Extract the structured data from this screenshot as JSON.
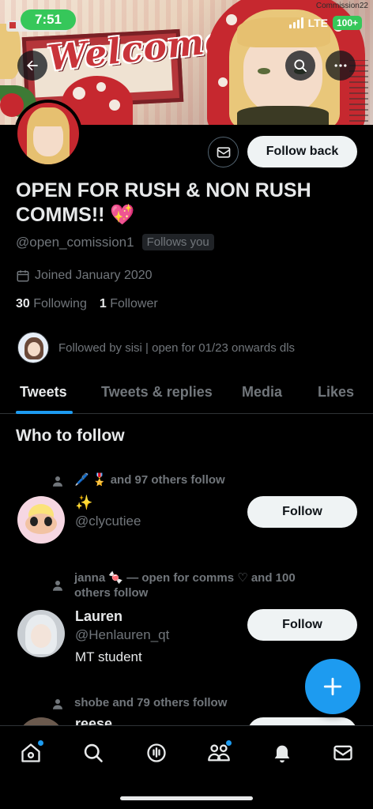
{
  "status_bar": {
    "time": "7:51",
    "network": "LTE",
    "battery": "100+"
  },
  "banner": {
    "welcome_text": "Welcome!",
    "corner_text": "Commission22"
  },
  "profile": {
    "display_name": "OPEN FOR RUSH & NON RUSH COMMS!! 💖",
    "handle": "@open_comission1",
    "follows_you": "Follows you",
    "joined": "Joined January 2020",
    "following_count": "30",
    "following_label": "Following",
    "followers_count": "1",
    "followers_label": "Follower",
    "followed_by": "Followed by sisi | open for 01/23 onwards dls",
    "follow_back_label": "Follow back"
  },
  "tabs": [
    {
      "label": "Tweets",
      "active": true
    },
    {
      "label": "Tweets & replies",
      "active": false
    },
    {
      "label": "Media",
      "active": false
    },
    {
      "label": "Likes",
      "active": false
    }
  ],
  "who_to_follow": {
    "title": "Who to follow",
    "suggestions": [
      {
        "social_context": "🖊️ 🎖️ and 97 others follow",
        "name": "✨",
        "handle": "@clycutiee",
        "bio": "",
        "button": "Follow"
      },
      {
        "social_context": "janna 🍬 — open for comms ♡ and 100 others follow",
        "name": "Lauren",
        "handle": "@Henlauren_qt",
        "bio": "MT student",
        "button": "Follow"
      },
      {
        "social_context": "shobe and 79 others follow",
        "name": "reese",
        "handle": "",
        "bio": "",
        "button": "Follow"
      }
    ]
  },
  "bottom_nav": [
    "home-icon",
    "search-icon",
    "spaces-icon",
    "communities-icon",
    "notifications-icon",
    "messages-icon"
  ],
  "colors": {
    "accent": "#1d9bf0",
    "background": "#000000",
    "muted_text": "#71767b",
    "primary_text": "#e7e9ea",
    "status_green": "#36c75a"
  }
}
